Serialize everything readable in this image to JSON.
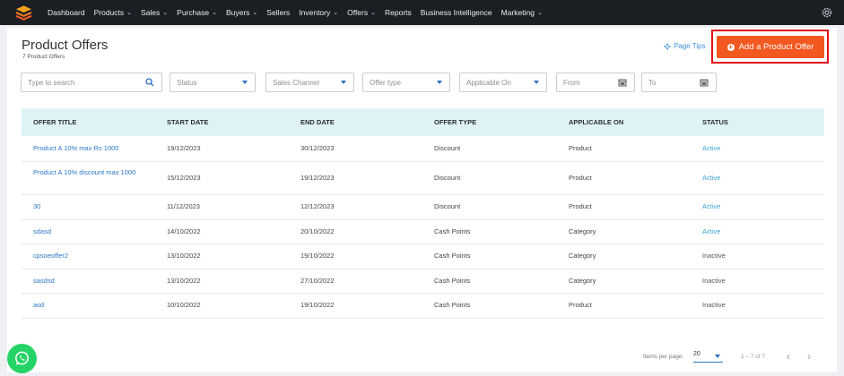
{
  "nav": {
    "items": [
      {
        "label": "Dashboard",
        "dropdown": false
      },
      {
        "label": "Products",
        "dropdown": true
      },
      {
        "label": "Sales",
        "dropdown": true
      },
      {
        "label": "Purchase",
        "dropdown": true
      },
      {
        "label": "Buyers",
        "dropdown": true
      },
      {
        "label": "Sellers",
        "dropdown": false
      },
      {
        "label": "Inventory",
        "dropdown": true
      },
      {
        "label": "Offers",
        "dropdown": true
      },
      {
        "label": "Reports",
        "dropdown": false
      },
      {
        "label": "Business Intelligence",
        "dropdown": false
      },
      {
        "label": "Marketing",
        "dropdown": true
      }
    ],
    "chevron": "⌄"
  },
  "header": {
    "title": "Product Offers",
    "subtitle": "7 Product Offers",
    "page_tips": "Page Tips",
    "add_button": "Add a Product Offer",
    "accent": "#f2581f"
  },
  "filters": {
    "search_placeholder": "Type to search",
    "status": "Status",
    "sales_channel": "Sales Channel",
    "offer_type": "Offer type",
    "applicable_on": "Applicable On",
    "from": "From",
    "to": "To"
  },
  "table": {
    "columns": [
      "OFFER TITLE",
      "START DATE",
      "END DATE",
      "OFFER TYPE",
      "APPLICABLE ON",
      "STATUS"
    ],
    "rows": [
      {
        "title": "Product A 10% max Rs 1000",
        "start": "19/12/2023",
        "end": "30/12/2023",
        "type": "Discount",
        "on": "Product",
        "status": "Active"
      },
      {
        "title": "Product A 10% discount max 1000",
        "start": "15/12/2023",
        "end": "19/12/2023",
        "type": "Discount",
        "on": "Product",
        "status": "Active"
      },
      {
        "title": "30",
        "start": "11/12/2023",
        "end": "12/12/2023",
        "type": "Discount",
        "on": "Product",
        "status": "Active"
      },
      {
        "title": "sdasd",
        "start": "14/10/2022",
        "end": "20/10/2022",
        "type": "Cash Points",
        "on": "Category",
        "status": "Active"
      },
      {
        "title": "cpsoeoffer2",
        "start": "13/10/2022",
        "end": "19/10/2022",
        "type": "Cash Points",
        "on": "Category",
        "status": "Inactive"
      },
      {
        "title": "sasdsd",
        "start": "13/10/2022",
        "end": "27/10/2022",
        "type": "Cash Points",
        "on": "Category",
        "status": "Inactive"
      },
      {
        "title": "asd",
        "start": "10/10/2022",
        "end": "19/10/2022",
        "type": "Cash Points",
        "on": "Product",
        "status": "Inactive"
      }
    ]
  },
  "pagination": {
    "items_per_page_label": "Items per page:",
    "items_per_page": "20",
    "range": "1 – 7 of 7",
    "prev": "‹",
    "next": "›"
  },
  "colors": {
    "navbar": "#1b1f24",
    "table_header": "#dff3f6",
    "link": "#2b78c6",
    "active": "#3aa5d8",
    "highlight_outline": "#e2101b"
  }
}
